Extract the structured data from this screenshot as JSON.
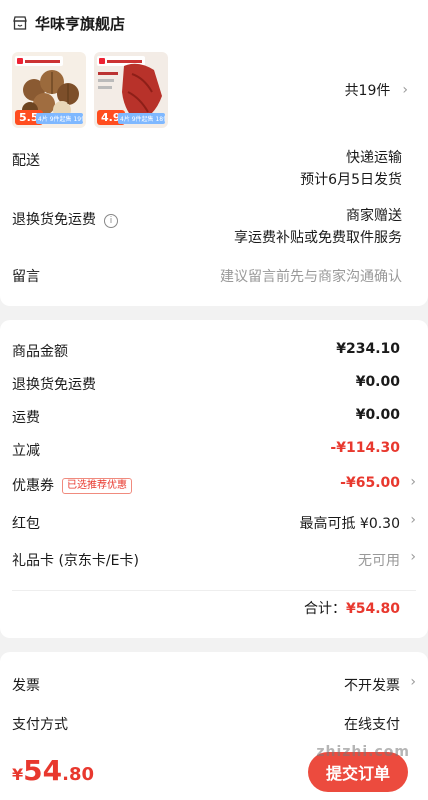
{
  "store": {
    "name": "华味亨旗舰店"
  },
  "products": [
    {
      "price_tag": "5.5",
      "promo": "4片 9件起售 19件"
    },
    {
      "price_tag": "4.9",
      "promo": "4片 9件起售 18件"
    }
  ],
  "item_count": "共19件",
  "delivery": {
    "label": "配送",
    "method": "快递运输",
    "eta": "预计6月5日发货"
  },
  "return_shipping": {
    "label": "退换货免运费",
    "value": "商家赠送",
    "subvalue": "享运费补贴或免费取件服务"
  },
  "message": {
    "label": "留言",
    "placeholder": "建议留言前先与商家沟通确认"
  },
  "prices": {
    "goods_label": "商品金额",
    "goods_value": "¥234.10",
    "return_label": "退换货免运费",
    "return_value": "¥0.00",
    "shipping_label": "运费",
    "shipping_value": "¥0.00",
    "discount_label": "立减",
    "discount_value": "-¥114.30",
    "coupon_label": "优惠券",
    "coupon_badge": "已选推荐优惠",
    "coupon_value": "-¥65.00",
    "redpacket_label": "红包",
    "redpacket_value": "最高可抵 ¥0.30",
    "giftcard_label": "礼品卡 (京东卡/E卡)",
    "giftcard_value": "无可用"
  },
  "total": {
    "label": "合计：",
    "value": "¥54.80"
  },
  "invoice": {
    "label": "发票",
    "value": "不开发票"
  },
  "payment": {
    "label": "支付方式",
    "value": "在线支付"
  },
  "footer": {
    "currency": "¥",
    "price_int": "54",
    "price_dec": ".80",
    "submit": "提交订单",
    "watermark": "zhizhi.com"
  },
  "colors": {
    "accent": "#e8382e",
    "button": "#ec4b3e"
  }
}
